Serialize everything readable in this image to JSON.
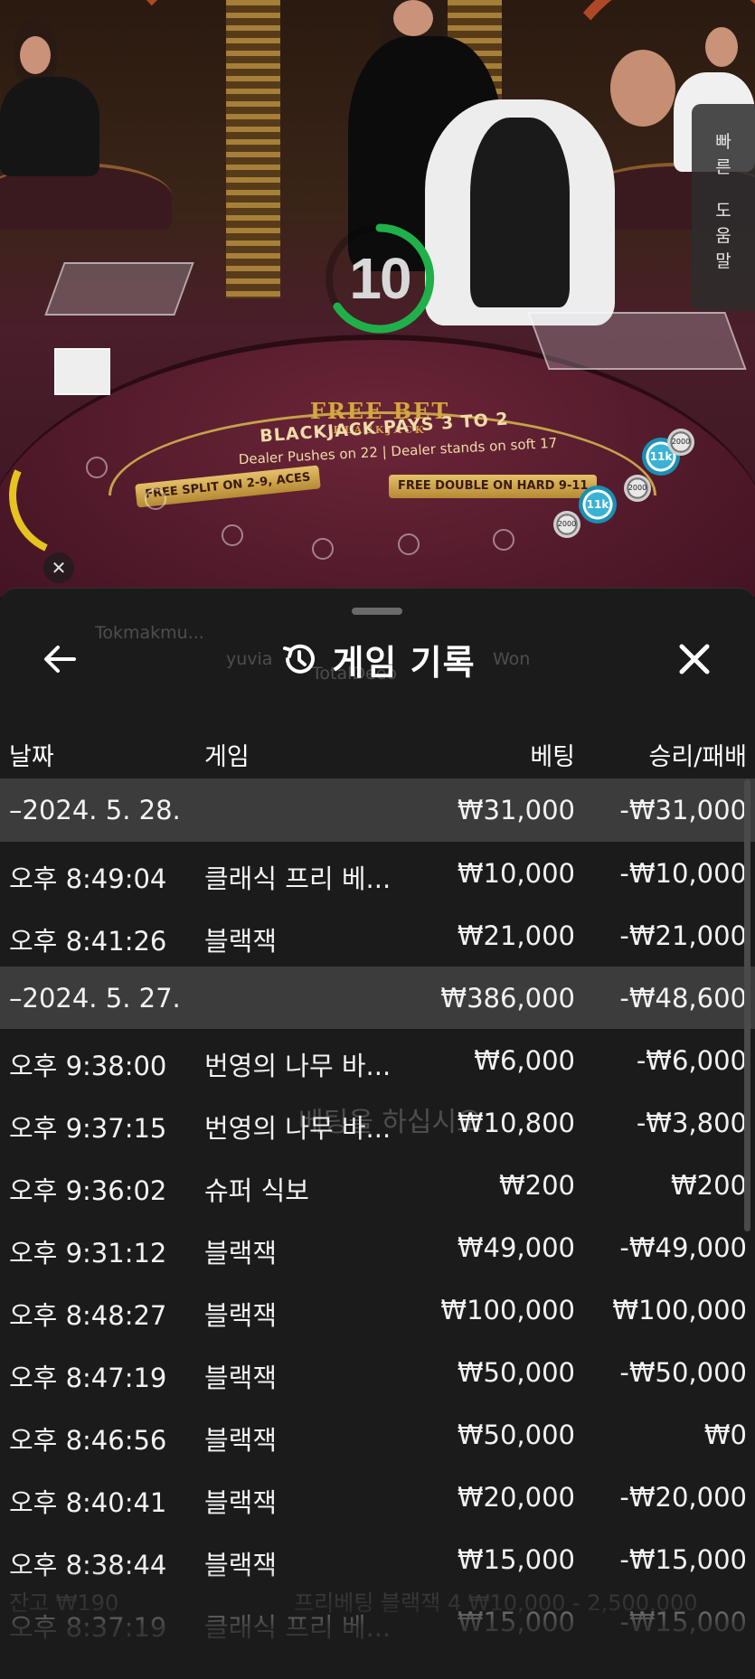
{
  "video": {
    "timer": "10",
    "table_logo": "FREE BET",
    "table_logo_sub": "BLACKJACK",
    "table_line1": "BLACKJACK PAYS 3 TO 2",
    "table_line2": "Dealer Pushes on 22  |  Dealer stands on soft 17",
    "table_pill_left": "FREE SPLIT ON 2-9, ACES",
    "table_pill_right": "FREE DOUBLE ON HARD 9-11",
    "chip_top": "11k",
    "chip_bottom": "11k",
    "chip_small_1": "2000",
    "chip_small_2": "2000",
    "chip_small_3": "2000",
    "quick_help_chars": [
      "빠",
      "른",
      "",
      "도",
      "움",
      "말"
    ],
    "close_glyph": "✕",
    "accent_timer": "#1fb04a",
    "accent_rail": "#e5c420"
  },
  "sheet": {
    "title": "게임 기록",
    "back_icon": "arrow-left-icon",
    "close_icon": "close-icon",
    "history_icon": "history-icon",
    "ghost": {
      "player1": "Tokmakmu...",
      "player2": "yuvia",
      "player3": "Won",
      "player4": "TotalDeeo",
      "prompt": "베팅을 하십시오",
      "balance": "잔고 ₩190",
      "table_info": "프리베팅 블랙잭 4  ₩10,000 - 2,500,000"
    },
    "columns": {
      "date": "날짜",
      "game": "게임",
      "bet": "베팅",
      "result": "승리/패배"
    },
    "rows": [
      {
        "type": "group",
        "date": "–2024. 5. 28.",
        "game": "",
        "bet": "₩31,000",
        "result": "-₩31,000"
      },
      {
        "type": "item",
        "date": "오후 8:49:04",
        "game": "클래식 프리 베...",
        "bet": "₩10,000",
        "result": "-₩10,000"
      },
      {
        "type": "item",
        "date": "오후 8:41:26",
        "game": "블랙잭",
        "bet": "₩21,000",
        "result": "-₩21,000"
      },
      {
        "type": "group",
        "date": "–2024. 5. 27.",
        "game": "",
        "bet": "₩386,000",
        "result": "-₩48,600"
      },
      {
        "type": "item",
        "date": "오후 9:38:00",
        "game": "번영의 나무 바...",
        "bet": "₩6,000",
        "result": "-₩6,000"
      },
      {
        "type": "item",
        "date": "오후 9:37:15",
        "game": "번영의 나무 바...",
        "bet": "₩10,800",
        "result": "-₩3,800"
      },
      {
        "type": "item",
        "date": "오후 9:36:02",
        "game": "슈퍼 식보",
        "bet": "₩200",
        "result": "₩200"
      },
      {
        "type": "item",
        "date": "오후 9:31:12",
        "game": "블랙잭",
        "bet": "₩49,000",
        "result": "-₩49,000"
      },
      {
        "type": "item",
        "date": "오후 8:48:27",
        "game": "블랙잭",
        "bet": "₩100,000",
        "result": "₩100,000"
      },
      {
        "type": "item",
        "date": "오후 8:47:19",
        "game": "블랙잭",
        "bet": "₩50,000",
        "result": "-₩50,000"
      },
      {
        "type": "item",
        "date": "오후 8:46:56",
        "game": "블랙잭",
        "bet": "₩50,000",
        "result": "₩0"
      },
      {
        "type": "item",
        "date": "오후 8:40:41",
        "game": "블랙잭",
        "bet": "₩20,000",
        "result": "-₩20,000"
      },
      {
        "type": "item",
        "date": "오후 8:38:44",
        "game": "블랙잭",
        "bet": "₩15,000",
        "result": "-₩15,000"
      },
      {
        "type": "item",
        "date": "오후 8:37:19",
        "game": "클래식 프리 베...",
        "bet": "₩15,000",
        "result": "-₩15,000"
      }
    ]
  }
}
